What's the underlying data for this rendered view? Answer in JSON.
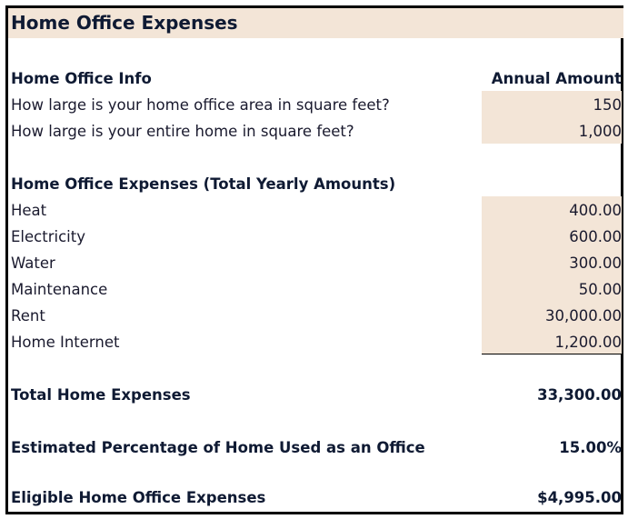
{
  "title": "Home Office Expenses",
  "info": {
    "heading": "Home Office Info",
    "amount_heading": "Annual Amount",
    "rows": [
      {
        "label": "How large is your home office area in square feet?",
        "value": "150"
      },
      {
        "label": "How large is your entire home in square feet?",
        "value": "1,000"
      }
    ]
  },
  "expenses": {
    "heading": "Home Office Expenses (Total Yearly Amounts)",
    "rows": [
      {
        "label": "Heat",
        "value": "400.00"
      },
      {
        "label": "Electricity",
        "value": "600.00"
      },
      {
        "label": "Water",
        "value": "300.00"
      },
      {
        "label": "Maintenance",
        "value": "50.00"
      },
      {
        "label": "Rent",
        "value": "30,000.00"
      },
      {
        "label": "Home Internet",
        "value": "1,200.00"
      }
    ]
  },
  "summary": {
    "total_label": "Total Home Expenses",
    "total_value": "33,300.00",
    "percent_label": "Estimated Percentage of Home Used as an Office",
    "percent_value": "15.00%",
    "eligible_label": "Eligible Home Office Expenses",
    "eligible_value": "$4,995.00"
  },
  "colors": {
    "input_fill": "#f3e5d7",
    "border": "#000000",
    "text": "#0f1a33"
  }
}
